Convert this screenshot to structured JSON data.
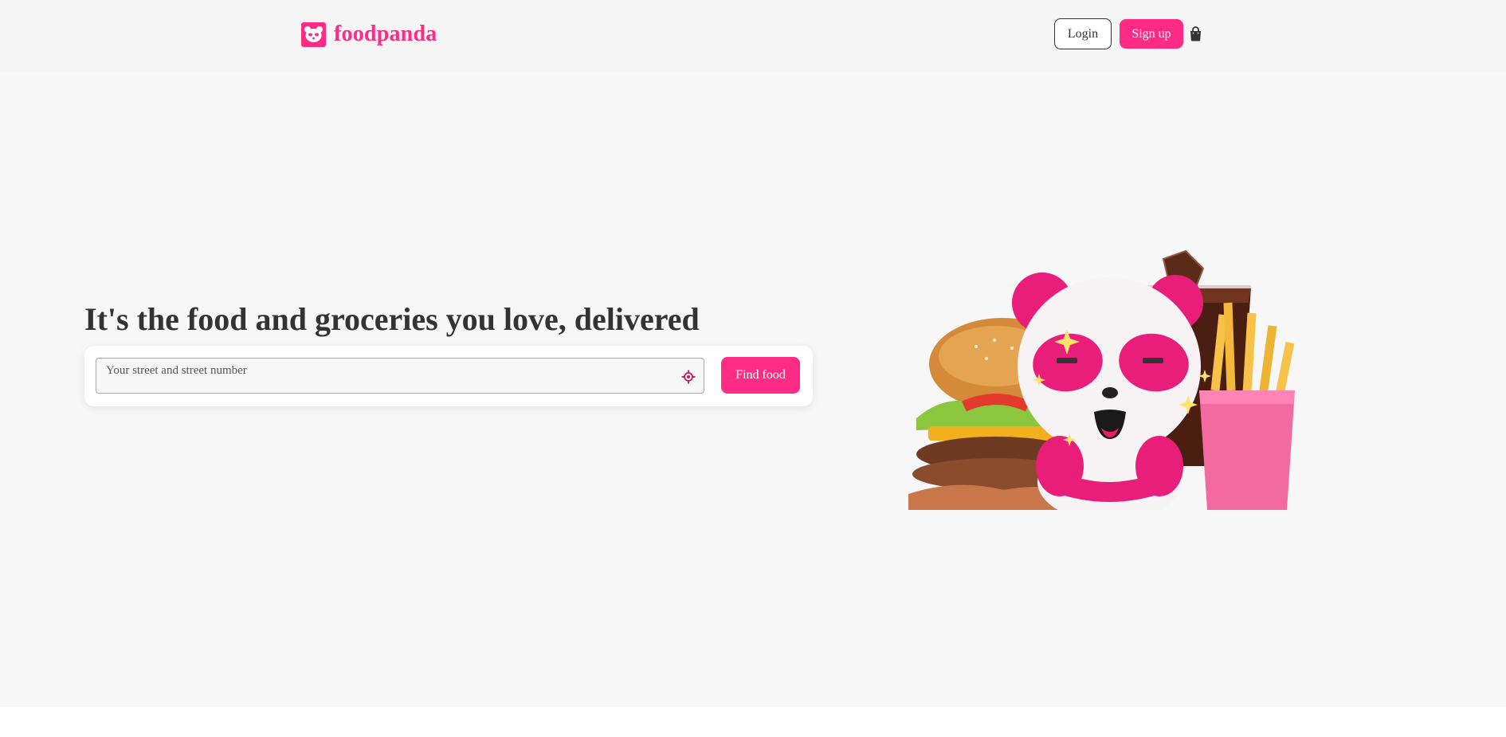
{
  "header": {
    "logo_text": "foodpanda",
    "login_label": "Login",
    "signup_label": "Sign up",
    "cart_icon": "shopping-bag-icon"
  },
  "hero": {
    "headline": "It's the food and groceries you love, delivered",
    "search": {
      "placeholder": "Your street and street number",
      "value": "",
      "locate_icon": "crosshair-locate-icon"
    },
    "find_food_label": "Find food",
    "illustration_icon": "panda-with-burger-fries-drink-illustration"
  },
  "colors": {
    "brand": "#ff2b85",
    "heading": "#333333",
    "header_bg": "#f5f5f5",
    "hero_bg": "#f7f7f7"
  }
}
